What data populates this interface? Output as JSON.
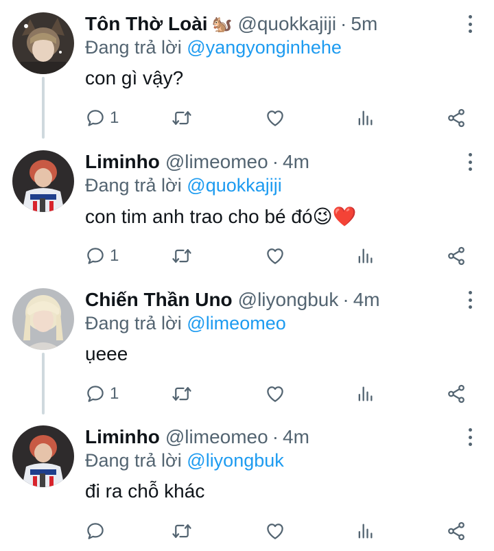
{
  "tweets": [
    {
      "display_name": "Tôn Thờ Loài",
      "name_emoji": "🐿️",
      "handle": "@quokkajiji",
      "separator": "·",
      "time": "5m",
      "reply_prefix": "Đang trả lời",
      "reply_to": "@yangyonginhehe",
      "text": "con gì vậy?",
      "text_emoji": "",
      "reply_count": "1"
    },
    {
      "display_name": "Liminho",
      "name_emoji": "",
      "handle": "@limeomeo",
      "separator": "·",
      "time": "4m",
      "reply_prefix": "Đang trả lời",
      "reply_to": "@quokkajiji",
      "text": "con tim anh trao cho bé đó",
      "text_emoji": "😉❤️",
      "reply_count": "1"
    },
    {
      "display_name": "Chiến Thần Uno",
      "name_emoji": "",
      "handle": "@liyongbuk",
      "separator": "·",
      "time": "4m",
      "reply_prefix": "Đang trả lời",
      "reply_to": "@limeomeo",
      "text": "ụeee",
      "text_emoji": "",
      "reply_count": "1"
    },
    {
      "display_name": "Liminho",
      "name_emoji": "",
      "handle": "@limeomeo",
      "separator": "·",
      "time": "4m",
      "reply_prefix": "Đang trả lời",
      "reply_to": "@liyongbuk",
      "text": "đi ra chỗ khác",
      "text_emoji": "",
      "reply_count": ""
    }
  ],
  "icons": {
    "reply": "reply-icon",
    "retweet": "retweet-icon",
    "like": "heart-icon",
    "views": "analytics-icon",
    "share": "share-icon",
    "more": "more-options-icon"
  },
  "colors": {
    "mention": "#1d9bf0",
    "secondary_text": "#536471",
    "primary_text": "#0f1419",
    "thread_line": "#cfd9de"
  }
}
